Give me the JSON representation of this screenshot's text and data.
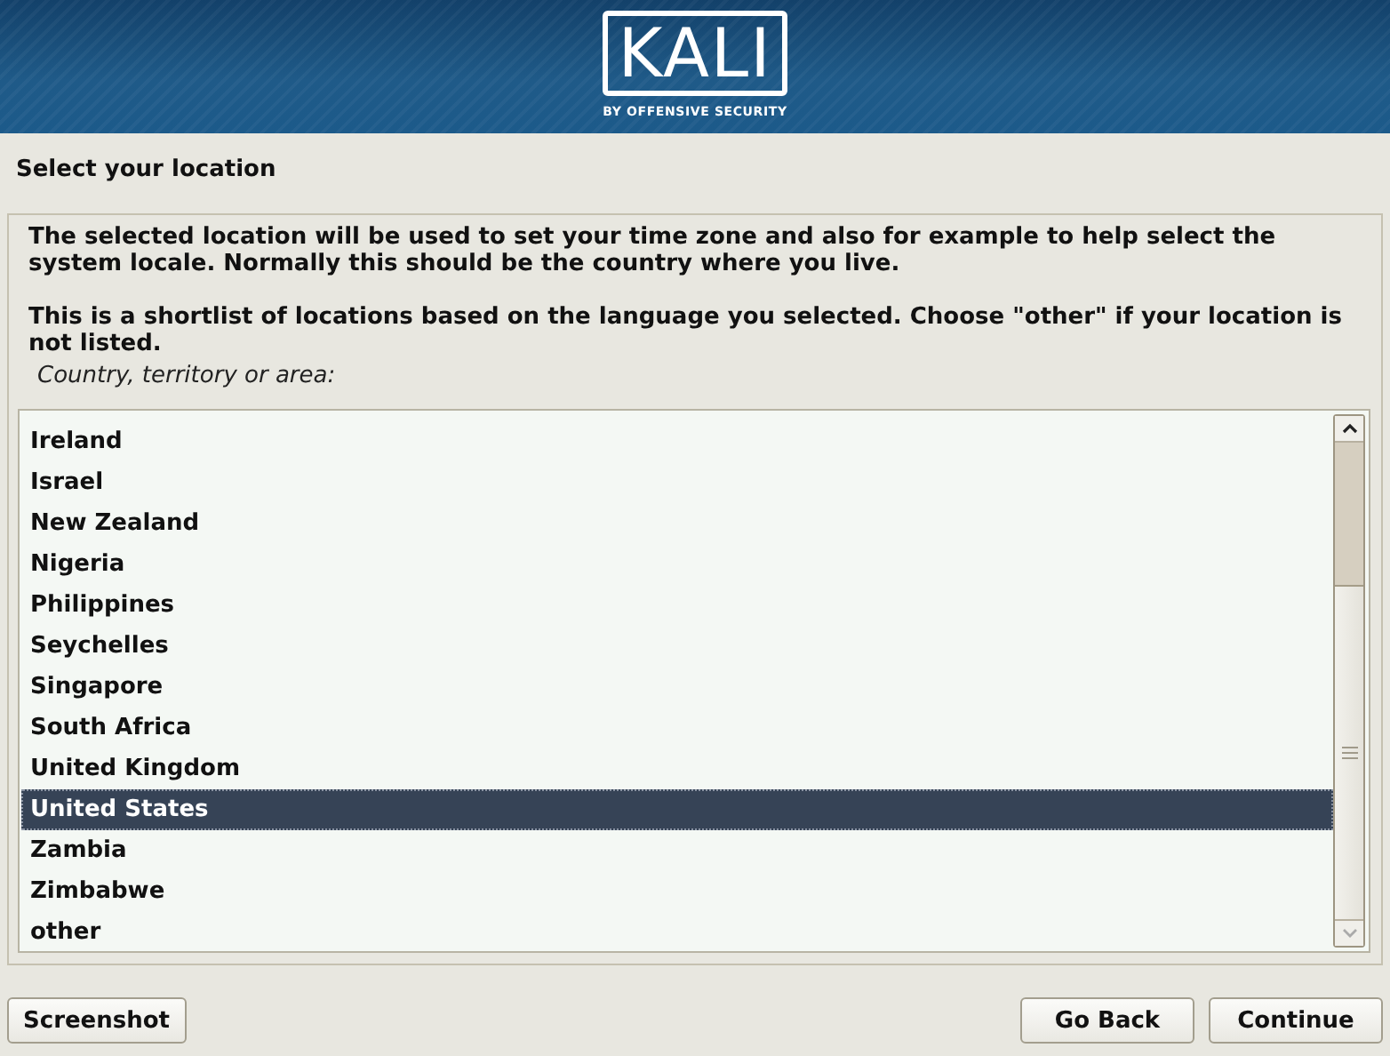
{
  "header": {
    "logo": "KALI",
    "tagline": "BY OFFENSIVE SECURITY"
  },
  "title": "Select your location",
  "description": [
    "The selected location will be used to set your time zone and also for example to help select the system locale. Normally this should be the country where you live.",
    "This is a shortlist of locations based on the language you selected. Choose \"other\" if your location is not listed."
  ],
  "list": {
    "label": "Country, territory or area:",
    "items": [
      {
        "label": "Ireland",
        "selected": false
      },
      {
        "label": "Israel",
        "selected": false
      },
      {
        "label": "New Zealand",
        "selected": false
      },
      {
        "label": "Nigeria",
        "selected": false
      },
      {
        "label": "Philippines",
        "selected": false
      },
      {
        "label": "Seychelles",
        "selected": false
      },
      {
        "label": "Singapore",
        "selected": false
      },
      {
        "label": "South Africa",
        "selected": false
      },
      {
        "label": "United Kingdom",
        "selected": false
      },
      {
        "label": "United States",
        "selected": true
      },
      {
        "label": "Zambia",
        "selected": false
      },
      {
        "label": "Zimbabwe",
        "selected": false
      },
      {
        "label": "other",
        "selected": false
      }
    ]
  },
  "buttons": {
    "left": [
      "Screenshot"
    ],
    "right": [
      "Go Back",
      "Continue"
    ]
  }
}
